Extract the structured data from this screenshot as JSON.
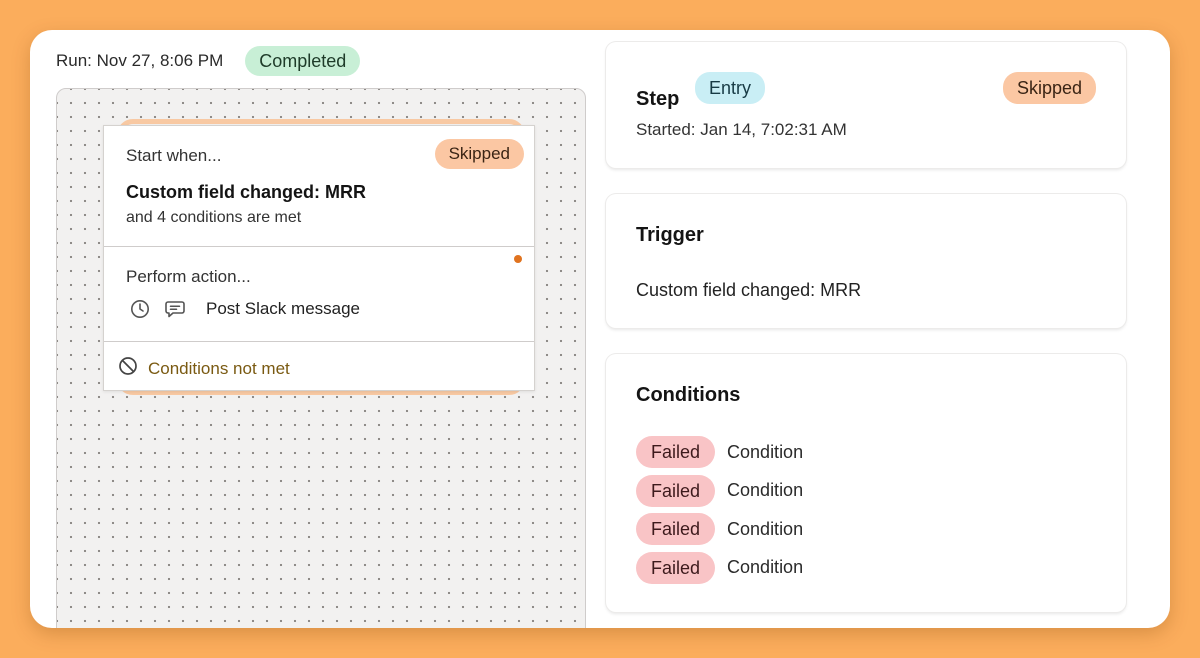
{
  "run": {
    "label": "Run: Nov 27, 8:06 PM",
    "status": "Completed"
  },
  "node": {
    "start_label": "Start when...",
    "start_status": "Skipped",
    "trigger_title": "Custom field changed: MRR",
    "trigger_subtitle": "and 4 conditions are met",
    "action_label": "Perform action...",
    "action_icons": [
      "clock-icon",
      "chat-bubble-icon"
    ],
    "action_text": "Post Slack message",
    "condition_icon": "no-entry-icon",
    "condition_status": "Conditions not met"
  },
  "step_panel": {
    "title": "Step",
    "type_badge": "Entry",
    "status_badge": "Skipped",
    "started": "Started: Jan 14, 7:02:31 AM"
  },
  "trigger_panel": {
    "title": "Trigger",
    "value": "Custom field changed: MRR"
  },
  "conditions_panel": {
    "title": "Conditions",
    "items": [
      {
        "status": "Failed",
        "label": "Condition"
      },
      {
        "status": "Failed",
        "label": "Condition"
      },
      {
        "status": "Failed",
        "label": "Condition"
      },
      {
        "status": "Failed",
        "label": "Condition"
      }
    ]
  },
  "colors": {
    "background": "#fbad5c",
    "completed_badge": "#c8efd6",
    "skipped_badge": "#fbc7a3",
    "entry_badge": "#c9eef5",
    "failed_badge": "#f9c4c6",
    "node_accent": "#e4652c",
    "conditions_text": "#7a5a12"
  }
}
